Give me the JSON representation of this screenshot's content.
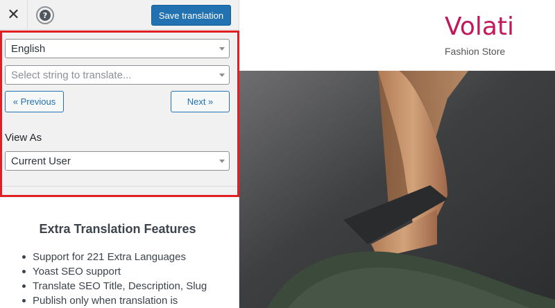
{
  "toolbar": {
    "close_icon": "close-icon",
    "help_icon": "help-icon",
    "help_glyph": "?",
    "save_label": "Save translation"
  },
  "translator": {
    "language_select": "English",
    "string_select_placeholder": "Select string to translate...",
    "previous_label": "« Previous",
    "next_label": "Next »",
    "view_as_label": "View As",
    "view_as_select": "Current User"
  },
  "features": {
    "title": "Extra Translation Features",
    "items": [
      "Support for 221 Extra Languages",
      "Yoast SEO support",
      "Translate SEO Title, Description, Slug",
      "Publish only when translation is"
    ]
  },
  "preview": {
    "brand": "Volati",
    "tagline": "Fashion Store"
  },
  "colors": {
    "accent": "#2271b1",
    "highlight_border": "#e01e24",
    "brand": "#c2185b"
  }
}
